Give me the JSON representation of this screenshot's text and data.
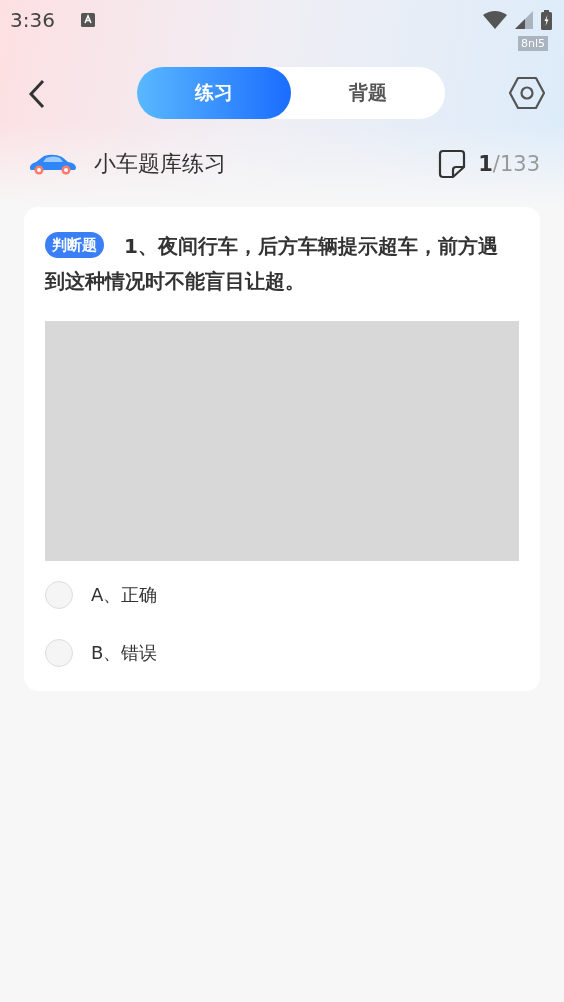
{
  "status_bar": {
    "time": "3:36",
    "tag": "8nl5"
  },
  "tabs": [
    {
      "label": "练习",
      "selected": true
    },
    {
      "label": "背题",
      "selected": false
    }
  ],
  "bank": {
    "title": "小车题库练习",
    "current": "1",
    "total": "/133"
  },
  "question": {
    "type_badge": "判断题",
    "text": "1、夜间行车，后方车辆提示超车，前方遇到这种情况时不能盲目让超。",
    "image": {
      "kind": "placeholder"
    },
    "options": [
      {
        "label": "A、正确",
        "selected": false
      },
      {
        "label": "B、错误",
        "selected": false
      }
    ]
  }
}
